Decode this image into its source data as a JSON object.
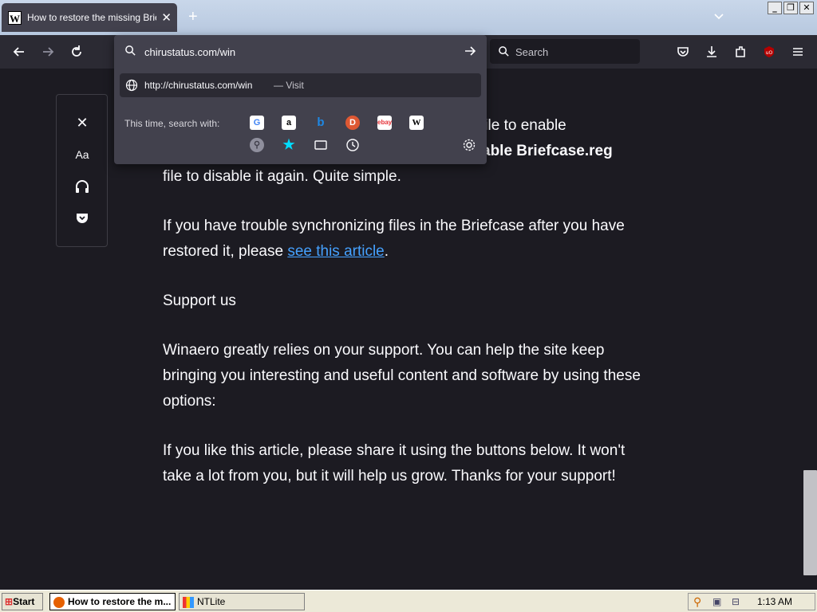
{
  "window": {
    "tab_title": "How to restore the missing Brie",
    "favicon_letter": "W",
    "new_tab": "+"
  },
  "toolbar": {
    "search_placeholder": "Search"
  },
  "url_popup": {
    "input_value": "chirustatus.com/win",
    "suggestion_url": "http://chirustatus.com/win",
    "suggestion_action": "— Visit",
    "search_with_label": "This time, search with:",
    "engines": [
      "google-icon",
      "amazon-icon",
      "bing-icon",
      "duckduckgo-icon",
      "ebay-icon",
      "wikipedia-icon",
      "search-engine-icon",
      "bookmarks-icon",
      "tabs-icon",
      "history-icon"
    ]
  },
  "reader_bar": {
    "close": "✕",
    "type_controls": "Aa"
  },
  "article": {
    "p1_line1_tail": "file to enable",
    "p1_line2_tail": "able Briefcase.reg",
    "p1_line3": "file to disable it again. Quite simple.",
    "p2_text": "If you have trouble synchronizing files in the Briefcase after you have restored it, please ",
    "p2_link": "see this article",
    "p2_end": ".",
    "p3": "Support us",
    "p4": "Winaero greatly relies on your support. You can help the site keep bringing you interesting and useful content and software by using these options:",
    "p5": "If you like this article, please share it using the buttons below. It won't take a lot from you, but it will help us grow. Thanks for your support!"
  },
  "taskbar": {
    "start": "Start",
    "task1": "How to restore the m...",
    "task2": "NTLite",
    "clock": "1:13 AM"
  },
  "colors": {
    "link": "#45a1ff",
    "page_bg": "#1c1b22",
    "toolbar_bg": "#2b2a33",
    "popup_bg": "#42414d"
  }
}
